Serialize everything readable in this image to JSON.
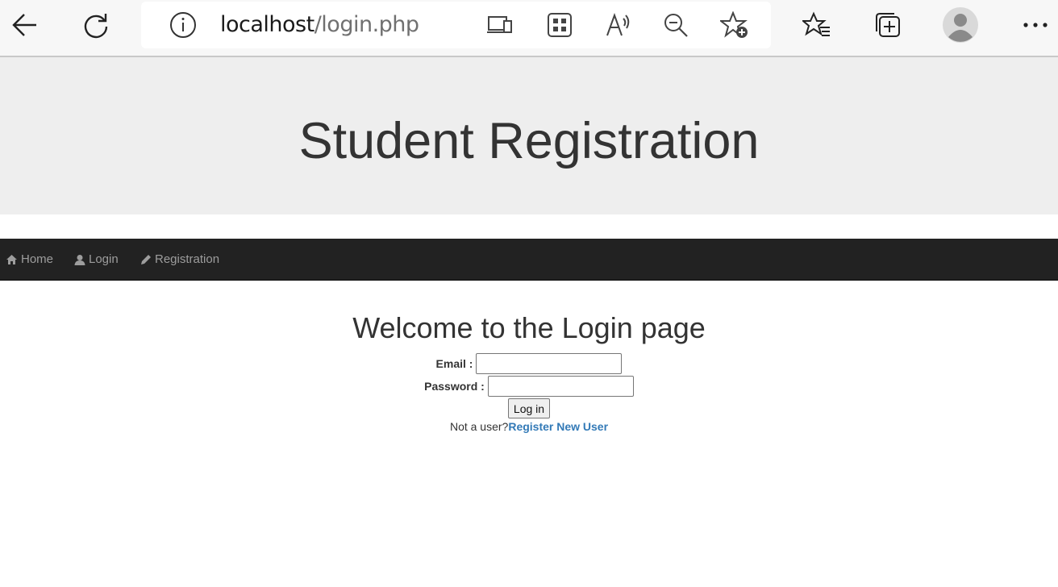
{
  "browser": {
    "url_host": "localhost",
    "url_path": "/login.php",
    "icons": [
      "back-icon",
      "refresh-icon",
      "info-icon",
      "app-available-icon",
      "grid-apps-icon",
      "read-aloud-icon",
      "zoom-out-icon",
      "add-favorite-icon",
      "favorites-icon",
      "collections-icon",
      "profile-avatar",
      "more-icon"
    ]
  },
  "header": {
    "title": "Student Registration"
  },
  "navbar": {
    "items": [
      {
        "label": "Home",
        "icon": "home-icon"
      },
      {
        "label": "Login",
        "icon": "user-icon"
      },
      {
        "label": "Registration",
        "icon": "pencil-icon"
      }
    ]
  },
  "login": {
    "heading": "Welcome to the Login page",
    "email_label": "Email :",
    "email_value": "",
    "password_label": "Password :",
    "password_value": "",
    "submit_label": "Log in",
    "not_user_text": "Not a user?",
    "register_link": "Register New User"
  },
  "colors": {
    "navbar_bg": "#222222",
    "jumbotron_bg": "#eeeeee",
    "link": "#337ab7",
    "nav_text": "#9d9d9d"
  }
}
